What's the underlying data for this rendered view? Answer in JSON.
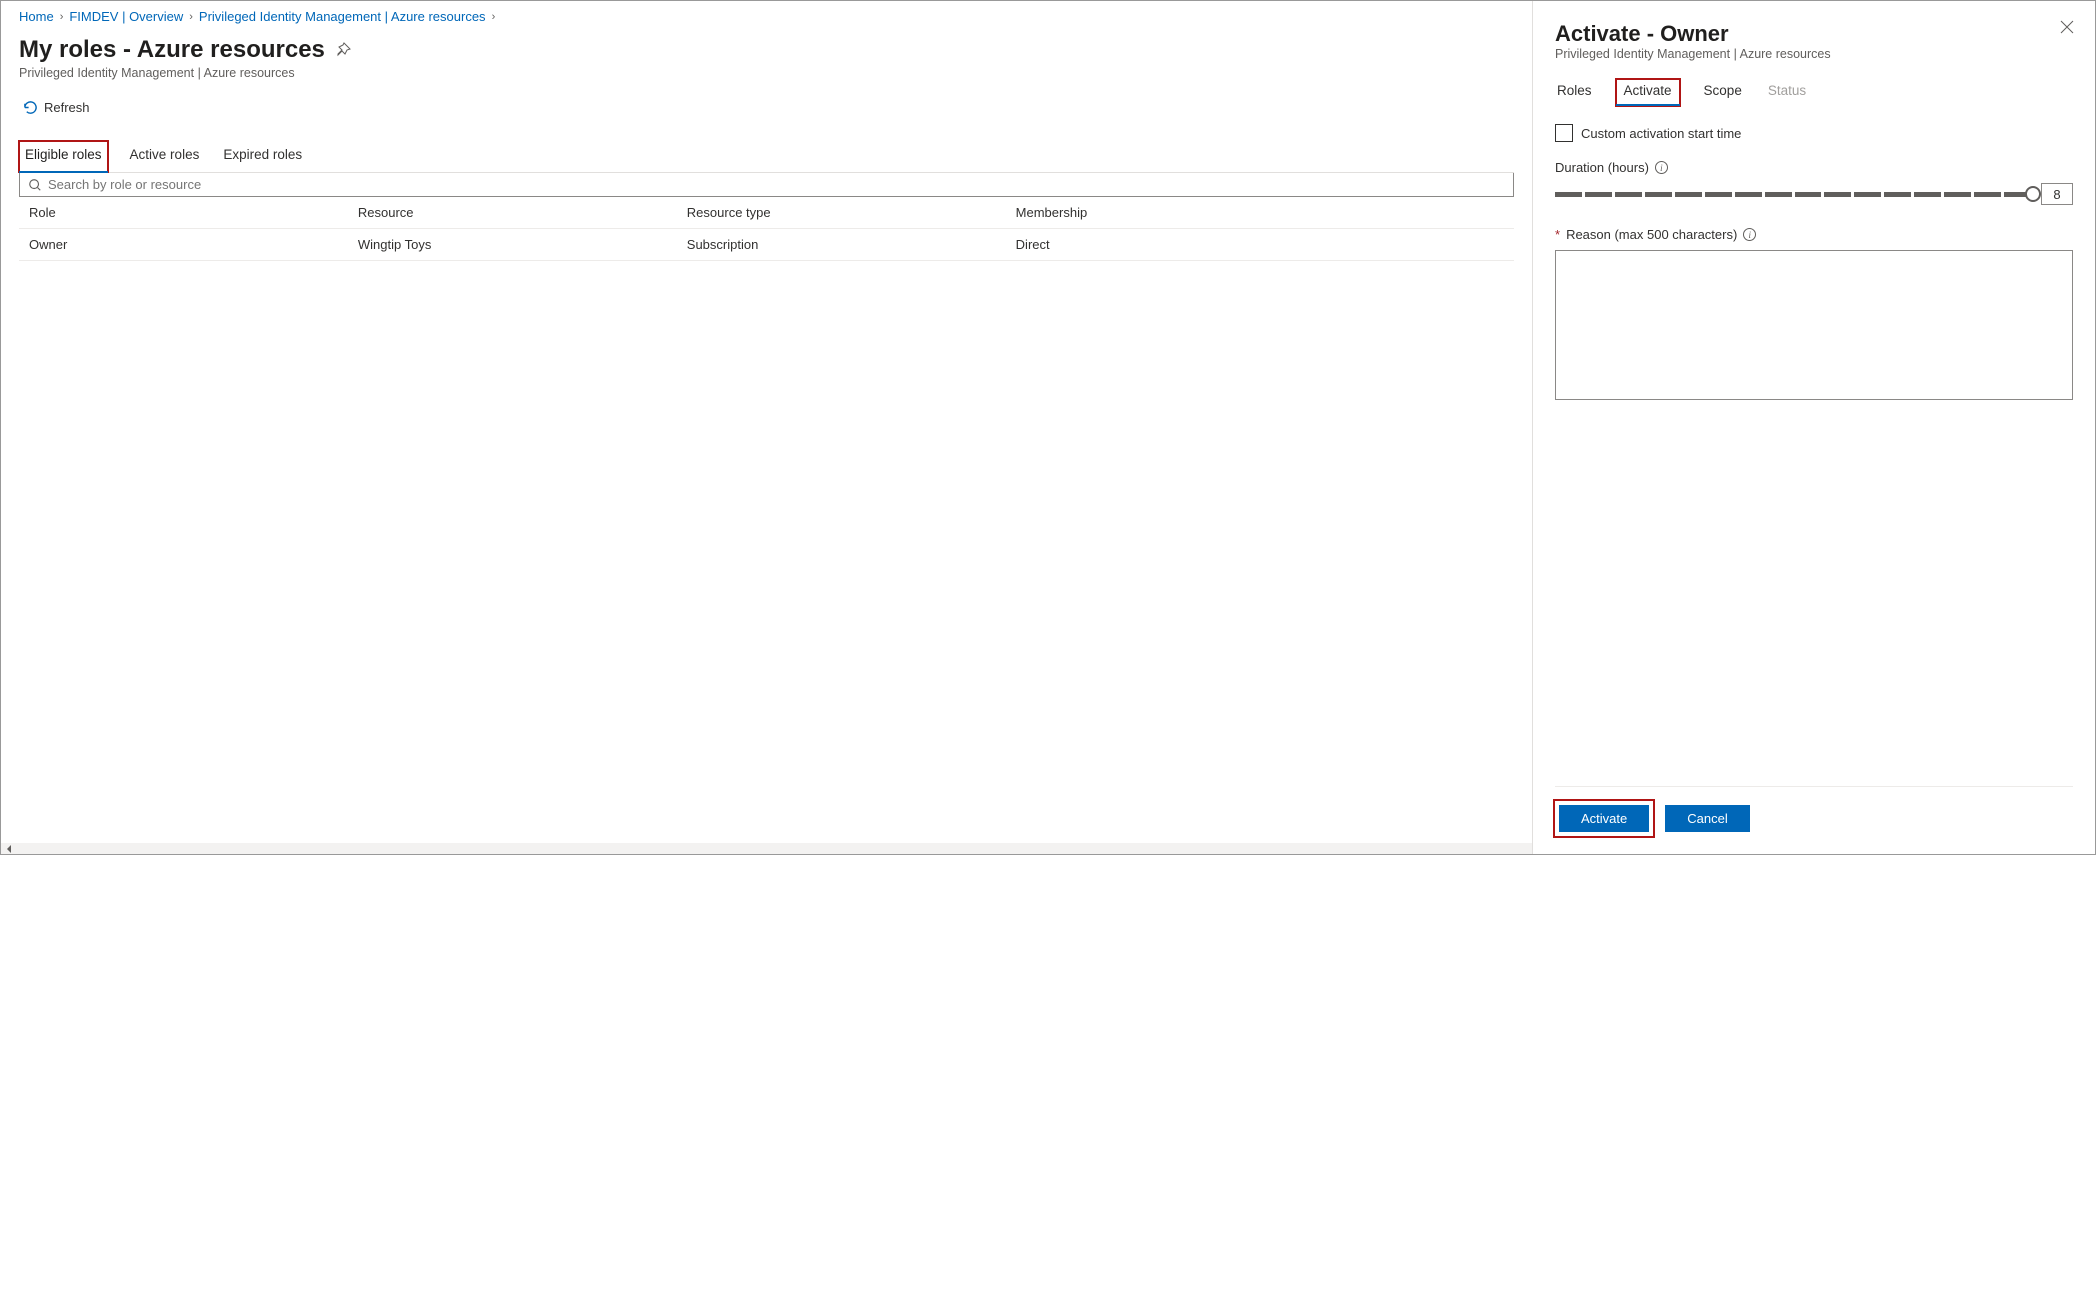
{
  "breadcrumb": [
    {
      "label": "Home",
      "link": true
    },
    {
      "label": "FIMDEV | Overview",
      "link": true
    },
    {
      "label": "Privileged Identity Management | Azure resources",
      "link": true
    },
    {
      "label": "",
      "link": false
    }
  ],
  "page_title": "My roles - Azure resources",
  "page_subtitle": "Privileged Identity Management | Azure resources",
  "refresh_label": "Refresh",
  "tabs": [
    {
      "label": "Eligible roles",
      "active": true,
      "highlight": true
    },
    {
      "label": "Active roles",
      "active": false,
      "highlight": false
    },
    {
      "label": "Expired roles",
      "active": false,
      "highlight": false
    }
  ],
  "search_placeholder": "Search by role or resource",
  "columns": [
    "Role",
    "Resource",
    "Resource type",
    "Membership"
  ],
  "rows": [
    {
      "role": "Owner",
      "resource": "Wingtip Toys",
      "resource_type": "Subscription",
      "membership": "Direct"
    }
  ],
  "panel": {
    "title": "Activate - Owner",
    "subtitle": "Privileged Identity Management | Azure resources",
    "tabs": [
      {
        "label": "Roles",
        "active": false,
        "highlight": false,
        "disabled": false
      },
      {
        "label": "Activate",
        "active": true,
        "highlight": true,
        "disabled": false
      },
      {
        "label": "Scope",
        "active": false,
        "highlight": false,
        "disabled": false
      },
      {
        "label": "Status",
        "active": false,
        "highlight": false,
        "disabled": true
      }
    ],
    "custom_start_label": "Custom activation start time",
    "duration_label": "Duration (hours)",
    "duration_value": "8",
    "reason_label": "Reason (max 500 characters)",
    "activate_button": "Activate",
    "cancel_button": "Cancel"
  }
}
